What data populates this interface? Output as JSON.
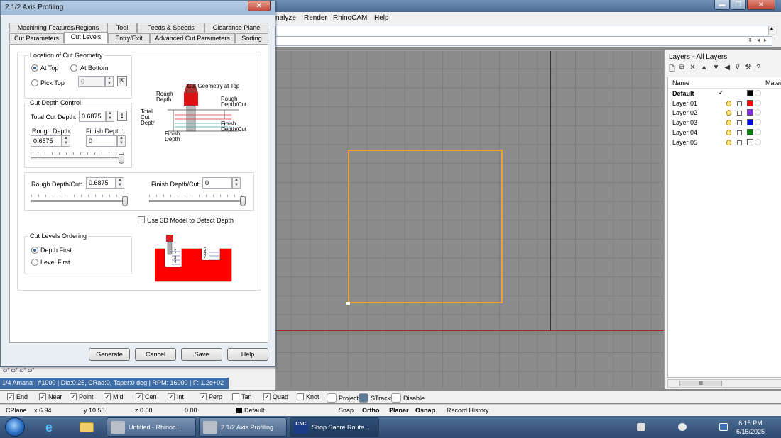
{
  "rhino": {
    "menu": [
      "nalyze",
      "Render",
      "RhinoCAM",
      "Help"
    ]
  },
  "dialog": {
    "title": "2 1/2 Axis Profiling",
    "close_glyph": "✕",
    "tabs_row1": [
      "Machining Features/Regions",
      "Tool",
      "Feeds & Speeds",
      "Clearance Plane"
    ],
    "tabs_row2": [
      "Cut Parameters",
      "Cut Levels",
      "Entry/Exit",
      "Advanced Cut Parameters",
      "Sorting"
    ],
    "active_tab": "Cut Levels",
    "location": {
      "title": "Location of Cut Geometry",
      "at_top": "At Top",
      "at_bottom": "At Bottom",
      "pick_top": "Pick Top",
      "pick_top_value": "0"
    },
    "depth_control": {
      "title": "Cut Depth Control",
      "total_label": "Total Cut Depth:",
      "total_value": "0.6875",
      "rough_label": "Rough Depth:",
      "rough_value": "0.6875",
      "finish_label": "Finish Depth:",
      "finish_value": "0",
      "rough_slider_fraction": 1.0
    },
    "per_cut": {
      "rough_label": "Rough Depth/Cut:",
      "rough_value": "0.6875",
      "rough_slider_fraction": 1.0,
      "finish_label": "Finish Depth/Cut:",
      "finish_value": "0",
      "finish_slider_fraction": 1.0
    },
    "use_3d": "Use 3D Model to Detect Depth",
    "diagram": {
      "cut_geom_top": "Cut Geometry at Top",
      "rough_depth": [
        "Rough",
        "Depth"
      ],
      "total_cut_depth": [
        "Total",
        "Cut",
        "Depth"
      ],
      "finish_depth": [
        "Finish",
        "Depth"
      ],
      "rough_depth_cut": [
        "Rough",
        "Depth/Cut"
      ],
      "finish_depth_cut": [
        "Finish",
        "Depth/Cut"
      ]
    },
    "ordering": {
      "title": "Cut Levels Ordering",
      "depth_first": "Depth First",
      "level_first": "Level First",
      "left_levels": [
        "1",
        "2",
        "3",
        "4"
      ],
      "right_levels": [
        "5",
        "6",
        "7"
      ]
    },
    "buttons": {
      "generate": "Generate",
      "cancel": "Cancel",
      "save": "Save",
      "help": "Help"
    }
  },
  "snap_strip": "ɷ° ɷ° ɷ° ɷ°",
  "tool_info": "1/4 Amana | #1000 | Dia:0.25, CRad:0, Taper:0 deg | RPM: 16000 | F: 1.2e+02",
  "layers": {
    "title": "Layers - All Layers",
    "toolbar_glyphs": [
      "🗋",
      "⧉",
      "✕",
      "▲",
      "▼",
      "◀",
      "⊽",
      "⚒",
      "?"
    ],
    "col_name": "Name",
    "col_material": "Mater",
    "rows": [
      {
        "name": "Default",
        "current": true,
        "color": "#000000"
      },
      {
        "name": "Layer 01",
        "current": false,
        "color": "#ff0000"
      },
      {
        "name": "Layer 02",
        "current": false,
        "color": "#8a2be2"
      },
      {
        "name": "Layer 03",
        "current": false,
        "color": "#0000ff"
      },
      {
        "name": "Layer 04",
        "current": false,
        "color": "#008000"
      },
      {
        "name": "Layer 05",
        "current": false,
        "color": "#ffffff"
      }
    ],
    "scroll_grip": "III"
  },
  "osnap": {
    "items": [
      {
        "label": "End",
        "checked": true
      },
      {
        "label": "Near",
        "checked": true
      },
      {
        "label": "Point",
        "checked": true
      },
      {
        "label": "Mid",
        "checked": true
      },
      {
        "label": "Cen",
        "checked": true
      },
      {
        "label": "Int",
        "checked": true
      },
      {
        "label": "Perp",
        "checked": true
      },
      {
        "label": "Tan",
        "checked": false
      },
      {
        "label": "Quad",
        "checked": true
      },
      {
        "label": "Knot",
        "checked": false
      }
    ],
    "toggles": [
      {
        "label": "Project",
        "active": false
      },
      {
        "label": "STrack",
        "active": true
      },
      {
        "label": "Disable",
        "active": false
      }
    ]
  },
  "status": {
    "cplane": "CPlane",
    "x": "x 6.94",
    "y": "y 10.55",
    "z": "z 0.00",
    "d": "0.00",
    "layer": "Default",
    "snap": "Snap",
    "ortho": "Ortho",
    "planar": "Planar",
    "osnap": "Osnap",
    "record": "Record History"
  },
  "taskbar": {
    "buttons": [
      {
        "label": "Untitled - Rhinoc..."
      },
      {
        "label": "2 1/2 Axis Profiling"
      },
      {
        "label": "Shop Sabre Route..."
      }
    ],
    "cnc_badge": "CNC",
    "time": "6:15 PM",
    "date": "6/15/2025"
  },
  "colors": {
    "accent_orange": "#f0a12c",
    "axis_red": "#a02626",
    "tool_info_bg": "#3e6ea8",
    "diagram_red": "#ff0000"
  }
}
